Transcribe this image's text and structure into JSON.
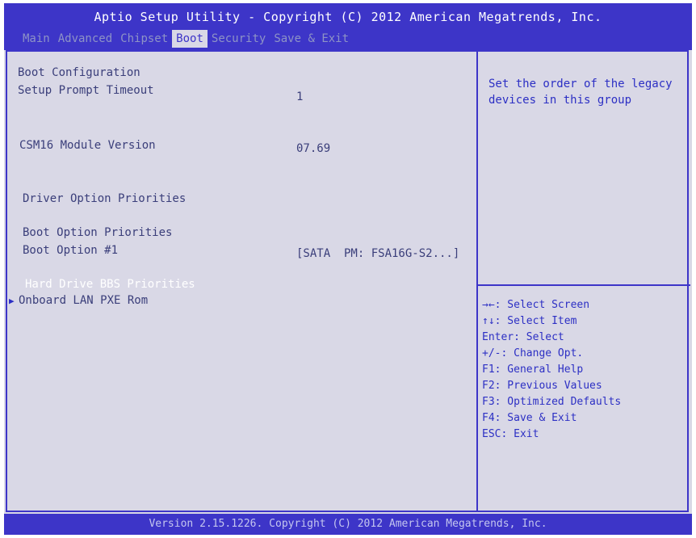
{
  "header": {
    "title": "Aptio Setup Utility - Copyright (C) 2012 American Megatrends, Inc.",
    "tabs": [
      {
        "label": "Main"
      },
      {
        "label": "Advanced"
      },
      {
        "label": "Chipset"
      },
      {
        "label": "Boot",
        "active": true
      },
      {
        "label": "Security"
      },
      {
        "label": "Save & Exit"
      }
    ]
  },
  "settings": {
    "boot_configuration": "Boot Configuration",
    "setup_prompt_timeout": {
      "label": "Setup Prompt Timeout",
      "value": "1"
    },
    "csm16_version": {
      "label": "CSM16 Module Version",
      "value": "07.69"
    },
    "driver_option_priorities": "Driver Option Priorities",
    "boot_option_priorities": "Boot Option Priorities",
    "boot_option_1": {
      "label": "Boot Option #1",
      "value": "[SATA  PM: FSA16G-S2...]"
    },
    "hard_drive_bbs": "Hard Drive BBS Priorities",
    "onboard_lan": "Onboard LAN PXE Rom"
  },
  "help": {
    "text": "Set the order of the legacy devices in this group"
  },
  "keys": [
    "→←: Select Screen",
    "↑↓: Select Item",
    "Enter: Select",
    "+/-: Change Opt.",
    "F1: General Help",
    "F2: Previous Values",
    "F3: Optimized Defaults",
    "F4: Save & Exit",
    "ESC: Exit"
  ],
  "footer": {
    "version": "Version 2.15.1226. Copyright (C) 2012 American Megatrends, Inc."
  },
  "colors": {
    "bios_blue": "#3d35c8",
    "background": "#d9d8e6",
    "text": "#3a3e7a",
    "help_text": "#2c2fc4"
  }
}
